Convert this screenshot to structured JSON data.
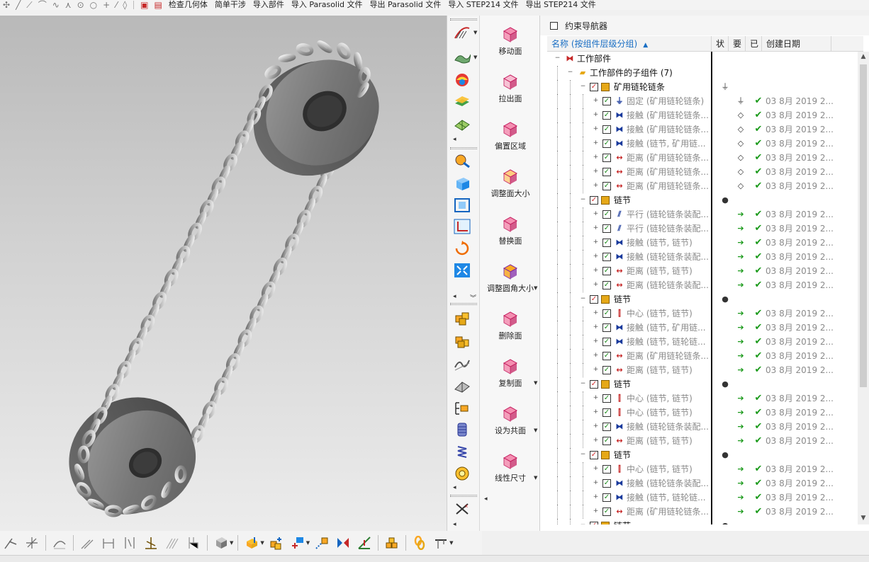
{
  "top_toolbar": {
    "items": [
      {
        "label": "检查几何体"
      },
      {
        "label": "简单干涉"
      },
      {
        "label": "导入部件"
      },
      {
        "label": "导入 Parasolid 文件"
      },
      {
        "label": "导出 Parasolid 文件"
      },
      {
        "label": "导入 STEP214 文件"
      },
      {
        "label": "导出 STEP214 文件"
      }
    ]
  },
  "feature_column": [
    {
      "label": "移动面",
      "icon": "move-face-icon"
    },
    {
      "label": "拉出面",
      "icon": "pull-face-icon"
    },
    {
      "label": "偏置区域",
      "icon": "offset-region-icon"
    },
    {
      "label": "调整面大小",
      "icon": "resize-face-icon"
    },
    {
      "label": "替换面",
      "icon": "replace-face-icon"
    },
    {
      "label": "调整圆角大小",
      "icon": "resize-blend-icon"
    },
    {
      "label": "删除面",
      "icon": "delete-face-icon"
    },
    {
      "label": "复制面",
      "icon": "copy-face-icon"
    },
    {
      "label": "设为共面",
      "icon": "make-coplanar-icon"
    },
    {
      "label": "线性尺寸",
      "icon": "linear-dimension-icon"
    }
  ],
  "navigator": {
    "title": "约束导航器",
    "columns": {
      "name": "名称 (按组件层级分组)",
      "status": "状",
      "required": "要",
      "done": "已",
      "date": "创建日期"
    },
    "rows": [
      {
        "level": 0,
        "kind": "root",
        "label": "工作部件",
        "grey": false
      },
      {
        "level": 1,
        "kind": "folder",
        "label": "工作部件的子组件 (7)",
        "grey": false
      },
      {
        "level": 2,
        "kind": "part",
        "label": "矿用链轮链条",
        "grey": false,
        "status": "⏚"
      },
      {
        "level": 3,
        "kind": "constraint",
        "ctype": "fix",
        "label": "固定 (矿用链轮链条)",
        "grey": true,
        "required": "⏚",
        "done": true,
        "date": "03 8月 2019 2..."
      },
      {
        "level": 3,
        "kind": "constraint",
        "ctype": "touch",
        "label": "接触 (矿用链轮链条...",
        "grey": true,
        "required": "◇",
        "done": true,
        "date": "03 8月 2019 2..."
      },
      {
        "level": 3,
        "kind": "constraint",
        "ctype": "touch",
        "label": "接触 (矿用链轮链条...",
        "grey": true,
        "required": "◇",
        "done": true,
        "date": "03 8月 2019 2..."
      },
      {
        "level": 3,
        "kind": "constraint",
        "ctype": "touch",
        "label": "接触 (链节, 矿用链...",
        "grey": true,
        "required": "◇",
        "done": true,
        "date": "03 8月 2019 2..."
      },
      {
        "level": 3,
        "kind": "constraint",
        "ctype": "distance",
        "label": "距离 (矿用链轮链条...",
        "grey": true,
        "required": "◇",
        "done": true,
        "date": "03 8月 2019 2..."
      },
      {
        "level": 3,
        "kind": "constraint",
        "ctype": "distance",
        "label": "距离 (矿用链轮链条...",
        "grey": true,
        "required": "◇",
        "done": true,
        "date": "03 8月 2019 2..."
      },
      {
        "level": 3,
        "kind": "constraint",
        "ctype": "distance",
        "label": "距离 (矿用链轮链条...",
        "grey": true,
        "required": "◇",
        "done": true,
        "date": "03 8月 2019 2..."
      },
      {
        "level": 2,
        "kind": "part",
        "label": "链节",
        "grey": false,
        "status": "●"
      },
      {
        "level": 3,
        "kind": "constraint",
        "ctype": "parallel",
        "label": "平行 (链轮链条装配...",
        "grey": true,
        "required": "➔",
        "done": true,
        "date": "03 8月 2019 2..."
      },
      {
        "level": 3,
        "kind": "constraint",
        "ctype": "parallel",
        "label": "平行 (链轮链条装配...",
        "grey": true,
        "required": "➔",
        "done": true,
        "date": "03 8月 2019 2..."
      },
      {
        "level": 3,
        "kind": "constraint",
        "ctype": "touch",
        "label": "接触 (链节, 链节)",
        "grey": true,
        "required": "➔",
        "done": true,
        "date": "03 8月 2019 2..."
      },
      {
        "level": 3,
        "kind": "constraint",
        "ctype": "touch",
        "label": "接触 (链轮链条装配...",
        "grey": true,
        "required": "➔",
        "done": true,
        "date": "03 8月 2019 2..."
      },
      {
        "level": 3,
        "kind": "constraint",
        "ctype": "distance",
        "label": "距离 (链节, 链节)",
        "grey": true,
        "required": "➔",
        "done": true,
        "date": "03 8月 2019 2..."
      },
      {
        "level": 3,
        "kind": "constraint",
        "ctype": "distance",
        "label": "距离 (链轮链条装配...",
        "grey": true,
        "required": "➔",
        "done": true,
        "date": "03 8月 2019 2..."
      },
      {
        "level": 2,
        "kind": "part",
        "label": "链节",
        "grey": false,
        "status": "●"
      },
      {
        "level": 3,
        "kind": "constraint",
        "ctype": "center",
        "label": "中心 (链节, 链节)",
        "grey": true,
        "required": "➔",
        "done": true,
        "date": "03 8月 2019 2..."
      },
      {
        "level": 3,
        "kind": "constraint",
        "ctype": "touch",
        "label": "接触 (链节, 矿用链...",
        "grey": true,
        "required": "➔",
        "done": true,
        "date": "03 8月 2019 2..."
      },
      {
        "level": 3,
        "kind": "constraint",
        "ctype": "touch",
        "label": "接触 (链节, 链轮链...",
        "grey": true,
        "required": "➔",
        "done": true,
        "date": "03 8月 2019 2..."
      },
      {
        "level": 3,
        "kind": "constraint",
        "ctype": "distance",
        "label": "距离 (矿用链轮链条...",
        "grey": true,
        "required": "➔",
        "done": true,
        "date": "03 8月 2019 2..."
      },
      {
        "level": 3,
        "kind": "constraint",
        "ctype": "distance",
        "label": "距离 (链节, 链节)",
        "grey": true,
        "required": "➔",
        "done": true,
        "date": "03 8月 2019 2..."
      },
      {
        "level": 2,
        "kind": "part",
        "label": "链节",
        "grey": false,
        "status": "●"
      },
      {
        "level": 3,
        "kind": "constraint",
        "ctype": "center",
        "label": "中心 (链节, 链节)",
        "grey": true,
        "required": "➔",
        "done": true,
        "date": "03 8月 2019 2..."
      },
      {
        "level": 3,
        "kind": "constraint",
        "ctype": "center",
        "label": "中心 (链节, 链节)",
        "grey": true,
        "required": "➔",
        "done": true,
        "date": "03 8月 2019 2..."
      },
      {
        "level": 3,
        "kind": "constraint",
        "ctype": "touch",
        "label": "接触 (链轮链条装配...",
        "grey": true,
        "required": "➔",
        "done": true,
        "date": "03 8月 2019 2..."
      },
      {
        "level": 3,
        "kind": "constraint",
        "ctype": "distance",
        "label": "距离 (链节, 链节)",
        "grey": true,
        "required": "➔",
        "done": true,
        "date": "03 8月 2019 2..."
      },
      {
        "level": 2,
        "kind": "part",
        "label": "链节",
        "grey": false,
        "status": "●"
      },
      {
        "level": 3,
        "kind": "constraint",
        "ctype": "center",
        "label": "中心 (链节, 链节)",
        "grey": true,
        "required": "➔",
        "done": true,
        "date": "03 8月 2019 2..."
      },
      {
        "level": 3,
        "kind": "constraint",
        "ctype": "touch",
        "label": "接触 (链轮链条装配...",
        "grey": true,
        "required": "➔",
        "done": true,
        "date": "03 8月 2019 2..."
      },
      {
        "level": 3,
        "kind": "constraint",
        "ctype": "touch",
        "label": "接触 (链节, 链轮链...",
        "grey": true,
        "required": "➔",
        "done": true,
        "date": "03 8月 2019 2..."
      },
      {
        "level": 3,
        "kind": "constraint",
        "ctype": "distance",
        "label": "距离 (矿用链轮链条...",
        "grey": true,
        "required": "➔",
        "done": true,
        "date": "03 8月 2019 2..."
      },
      {
        "level": 2,
        "kind": "part",
        "label": "链节",
        "grey": false,
        "status": "●"
      }
    ]
  },
  "colors": {
    "accent_blue": "#1a6fc4",
    "check_green": "#1b9a1b",
    "check_red": "#d32f2f",
    "part_cube": "#e6a817"
  }
}
